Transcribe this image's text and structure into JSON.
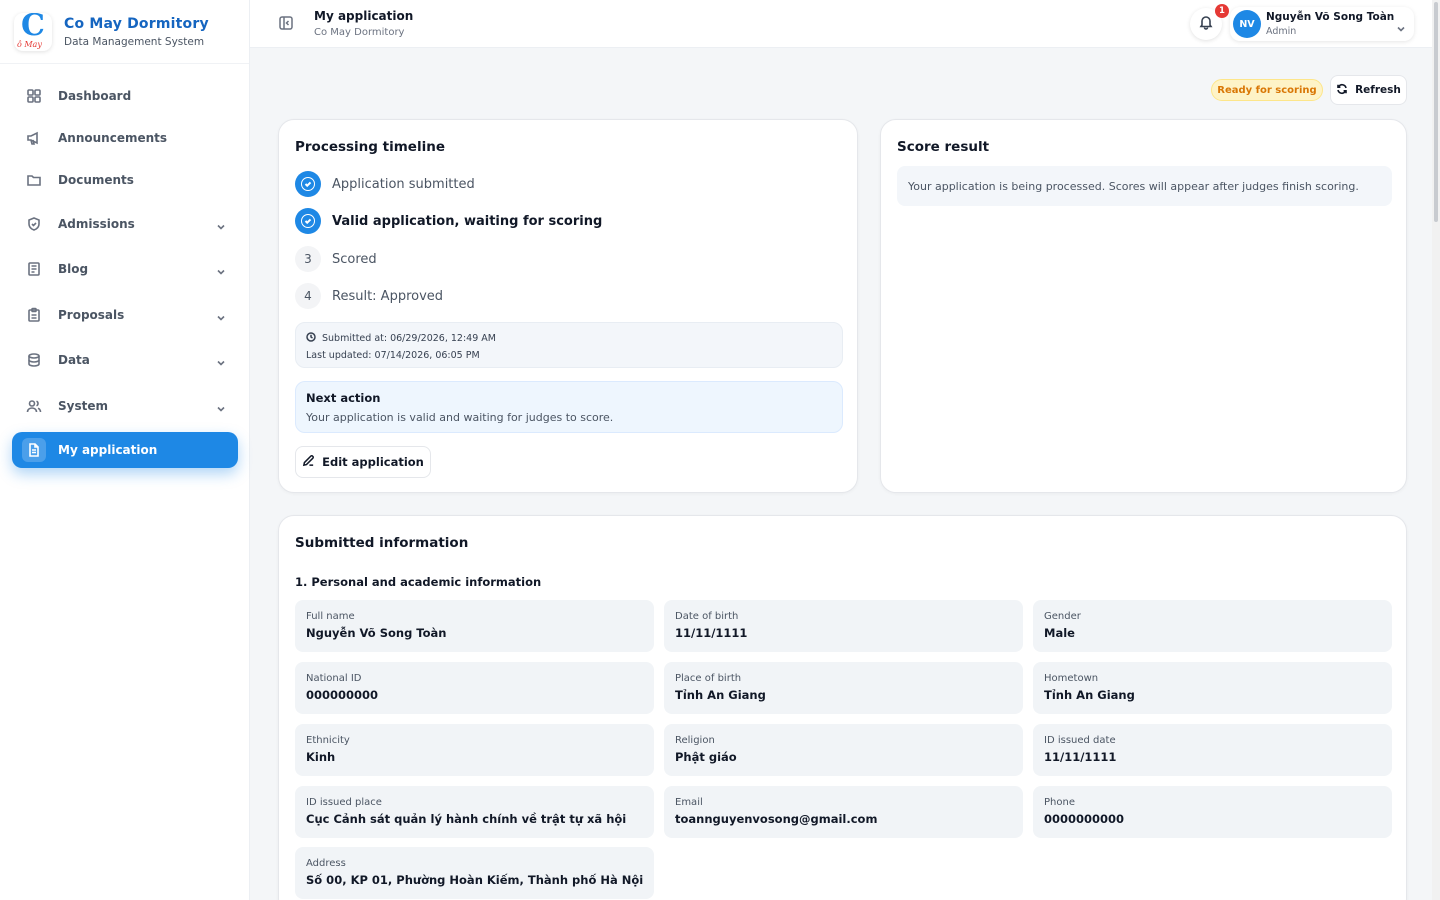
{
  "brand": {
    "logo_letter": "C",
    "logo_sub": "ô May",
    "title": "Co May Dormitory",
    "subtitle": "Data Management System"
  },
  "sidebar": {
    "items": [
      {
        "label": "Dashboard",
        "icon": "grid-icon"
      },
      {
        "label": "Announcements",
        "icon": "megaphone-icon"
      },
      {
        "label": "Documents",
        "icon": "folder-icon"
      },
      {
        "label": "Admissions",
        "icon": "shield-icon"
      },
      {
        "label": "Blog",
        "icon": "newspaper-icon"
      },
      {
        "label": "Proposals",
        "icon": "clipboard-icon"
      },
      {
        "label": "Data",
        "icon": "database-icon"
      },
      {
        "label": "System",
        "icon": "users-icon"
      },
      {
        "label": "My application",
        "icon": "file-text-icon"
      }
    ]
  },
  "header": {
    "title": "My application",
    "subtitle": "Co May Dormitory",
    "notifications_count": "1",
    "user": {
      "initials": "NV",
      "name": "Nguyễn Võ Song Toàn",
      "role": "Admin"
    }
  },
  "status": {
    "badge": "Ready for scoring",
    "refresh_label": "Refresh"
  },
  "colors": {
    "accent": "#1e88e5",
    "warning": "#d97706",
    "danger": "#e53935"
  },
  "timeline": {
    "title": "Processing timeline",
    "steps": [
      {
        "label": "Application submitted",
        "state": "done"
      },
      {
        "label": "Valid application, waiting for scoring",
        "state": "done"
      },
      {
        "number": "3",
        "label": "Scored",
        "state": "todo"
      },
      {
        "number": "4",
        "label": "Result: Approved",
        "state": "todo"
      }
    ],
    "submitted_at": "Submitted at: 06/29/2026, 12:49 AM",
    "last_updated": "Last updated: 07/14/2026, 06:05 PM",
    "next_action_title": "Next action",
    "next_action_text": "Your application is valid and waiting for judges to score.",
    "edit_label": "Edit application"
  },
  "score": {
    "title": "Score result",
    "message": "Your application is being processed. Scores will appear after judges finish scoring."
  },
  "submitted": {
    "title": "Submitted information",
    "section1": "1. Personal and academic information",
    "fields": [
      {
        "label": "Full name",
        "value": "Nguyễn Võ Song Toàn"
      },
      {
        "label": "Date of birth",
        "value": "11/11/1111"
      },
      {
        "label": "Gender",
        "value": "Male"
      },
      {
        "label": "National ID",
        "value": "000000000"
      },
      {
        "label": "Place of birth",
        "value": "Tỉnh An Giang"
      },
      {
        "label": "Hometown",
        "value": "Tỉnh An Giang"
      },
      {
        "label": "Ethnicity",
        "value": "Kinh"
      },
      {
        "label": "Religion",
        "value": "Phật giáo"
      },
      {
        "label": "ID issued date",
        "value": "11/11/1111"
      },
      {
        "label": "ID issued place",
        "value": "Cục Cảnh sát quản lý hành chính về trật tự xã hội"
      },
      {
        "label": "Email",
        "value": "toannguyenvosong@gmail.com"
      },
      {
        "label": "Phone",
        "value": "0000000000"
      },
      {
        "label": "Address",
        "value": "Số 00, KP 01, Phường Hoàn Kiếm, Thành phố Hà Nội"
      }
    ]
  }
}
